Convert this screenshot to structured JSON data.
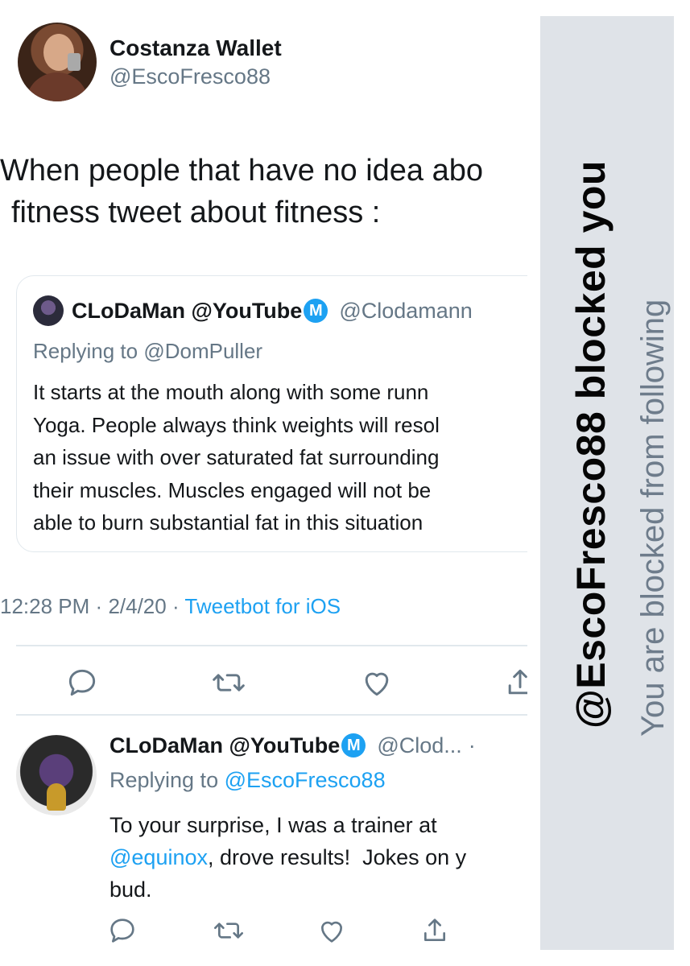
{
  "tweet": {
    "author": {
      "display_name": "Costanza Wallet",
      "handle": "@EscoFresco88"
    },
    "text": "When people that have no idea abo\nfitness tweet about fitness :",
    "quoted": {
      "author": {
        "display_name": "CLoDaMan @YouTube",
        "badge": "M",
        "handle": "@Clodamann"
      },
      "replying_label": "Replying to",
      "replying_to": "@DomPuller",
      "body_lines": [
        "It starts at the mouth along with some runn",
        "Yoga. People always think weights will resol",
        "an issue with over saturated fat surrounding",
        "their muscles. Muscles engaged will not be",
        "able to burn substantial fat in this situation"
      ]
    },
    "meta": {
      "time": "12:28 PM",
      "date": "2/4/20",
      "separator": "·",
      "client": "Tweetbot for iOS"
    },
    "actions": [
      "reply-icon",
      "retweet-icon",
      "like-icon",
      "share-icon"
    ]
  },
  "reply": {
    "author": {
      "display_name": "CLoDaMan @YouTube",
      "badge": "M",
      "handle": "@Clod...",
      "dot": "·"
    },
    "replying_label": "Replying to",
    "replying_to": "@EscoFresco88",
    "body_prefix": "To your surprise, I was a trainer at",
    "mention": "@equinox",
    "body_suffix": ", drove results!  Jokes on y\nbud.",
    "actions": [
      "reply-icon",
      "retweet-icon",
      "like-icon",
      "share-icon"
    ]
  },
  "blocked_panel": {
    "title": "@EscoFresco88 blocked you",
    "subtitle": "You are blocked from following"
  },
  "colors": {
    "link": "#1da1f2",
    "secondary_text": "#657786",
    "panel_background": "#dfe3e8",
    "divider": "#e1e8ed"
  }
}
